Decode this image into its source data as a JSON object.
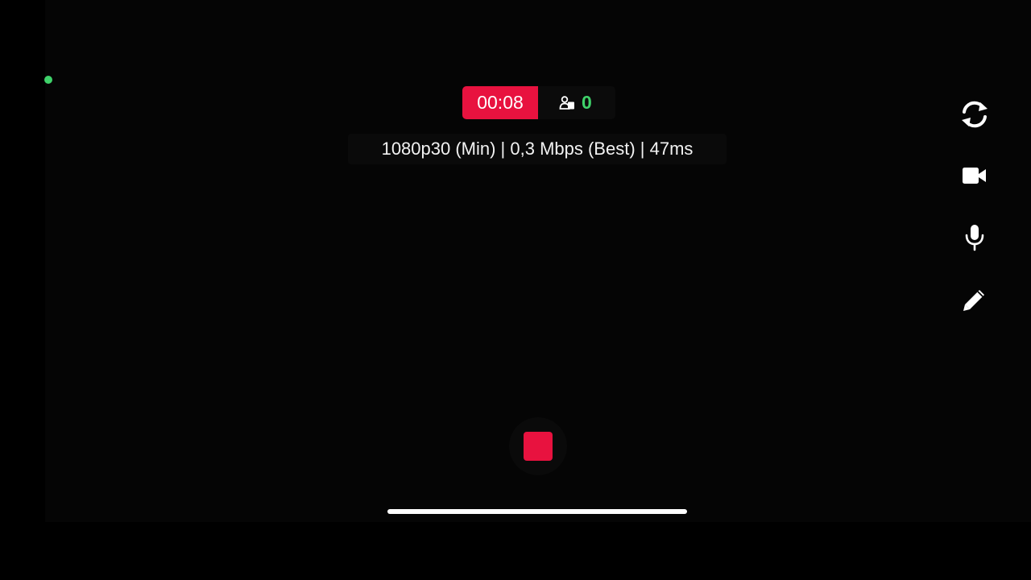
{
  "recording": {
    "timer": "00:08",
    "viewer_count": "0",
    "viewer_icon": "viewers-icon",
    "status_color": "#3fd26a",
    "accent_color": "#e8123f"
  },
  "stream_stats": {
    "text": "1080p30 (Min) | 0,3 Mbps (Best) | 47ms"
  },
  "side_controls": [
    {
      "icon": "switch-camera-icon"
    },
    {
      "icon": "video-camera-icon"
    },
    {
      "icon": "microphone-icon"
    },
    {
      "icon": "pencil-icon"
    }
  ],
  "stop_button": {
    "icon": "stop-icon"
  }
}
